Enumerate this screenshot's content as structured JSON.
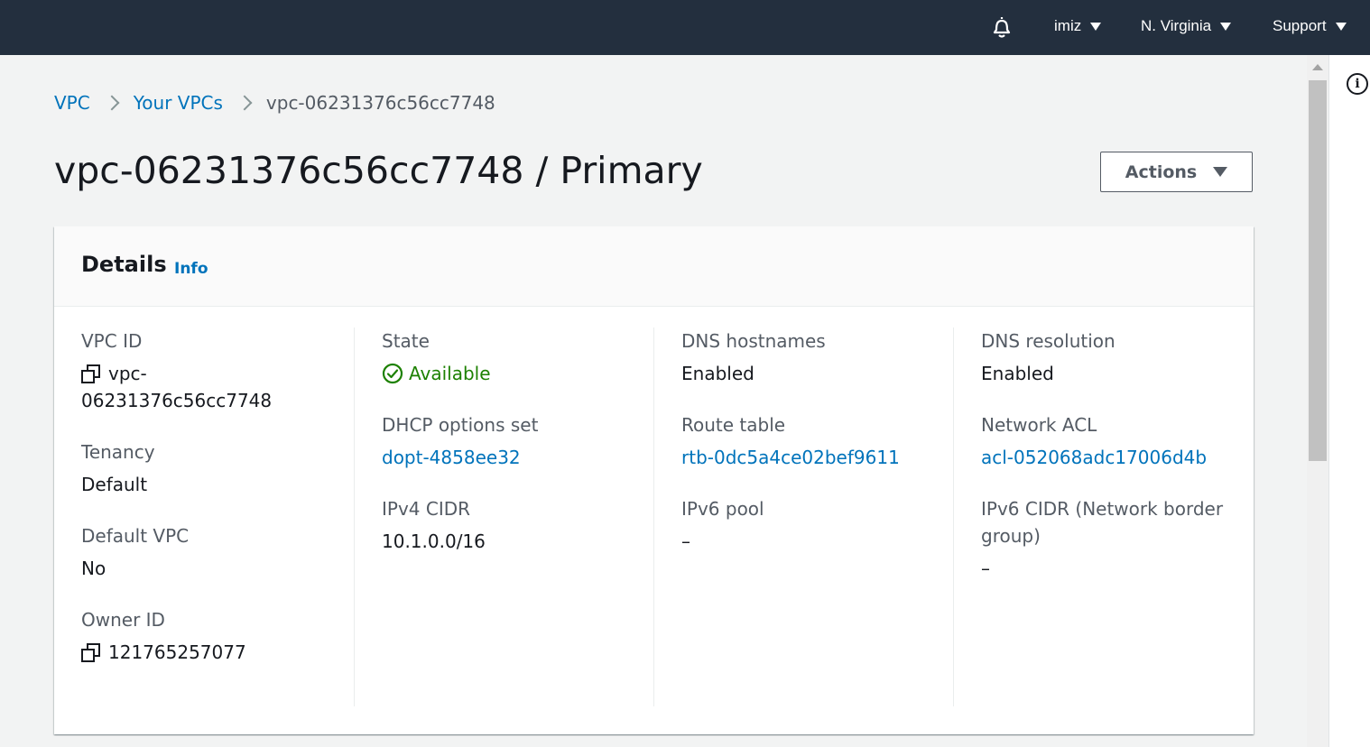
{
  "topnav": {
    "user_label": "imiz",
    "region_label": "N. Virginia",
    "support_label": "Support"
  },
  "breadcrumb": {
    "vpc": "VPC",
    "your_vpcs": "Your VPCs",
    "current": "vpc-06231376c56cc7748"
  },
  "page": {
    "title": "vpc-06231376c56cc7748 / Primary",
    "actions_label": "Actions"
  },
  "details": {
    "title": "Details",
    "info_label": "Info",
    "vpc_id": {
      "label": "VPC ID",
      "value_line1": "vpc-",
      "value_line2": "06231376c56cc7748"
    },
    "tenancy": {
      "label": "Tenancy",
      "value": "Default"
    },
    "default_vpc": {
      "label": "Default VPC",
      "value": "No"
    },
    "owner_id": {
      "label": "Owner ID",
      "value": "121765257077"
    },
    "state": {
      "label": "State",
      "value": "Available"
    },
    "dhcp": {
      "label": "DHCP options set",
      "value": "dopt-4858ee32"
    },
    "ipv4_cidr": {
      "label": "IPv4 CIDR",
      "value": "10.1.0.0/16"
    },
    "dns_hostnames": {
      "label": "DNS hostnames",
      "value": "Enabled"
    },
    "route_table": {
      "label": "Route table",
      "value": "rtb-0dc5a4ce02bef9611"
    },
    "ipv6_pool": {
      "label": "IPv6 pool",
      "value": "–"
    },
    "dns_resolution": {
      "label": "DNS resolution",
      "value": "Enabled"
    },
    "network_acl": {
      "label": "Network ACL",
      "value": "acl-052068adc17006d4b"
    },
    "ipv6_cidr": {
      "label": "IPv6 CIDR (Network border group)",
      "value": "–"
    }
  },
  "colors": {
    "nav_bg": "#232f3e",
    "link": "#0073bb",
    "success": "#1d8102",
    "page_bg": "#f2f3f3"
  },
  "icons": [
    "bell-icon",
    "caret-down-icon",
    "copy-icon",
    "check-circle-icon",
    "info-circle-icon",
    "chevron-right-icon"
  ]
}
